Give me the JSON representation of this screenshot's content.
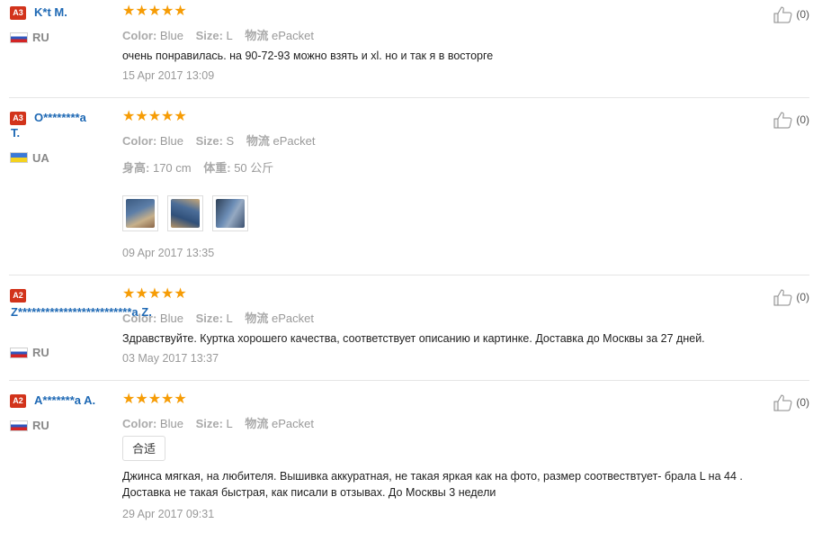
{
  "labels": {
    "color": "Color:",
    "size": "Size:",
    "shipping": "物流",
    "height": "身高:",
    "weight": "体重:"
  },
  "rating_stars": "★★★★★",
  "reviews": [
    {
      "badge": "A3",
      "name": "K*t M.",
      "country": "RU",
      "flag": "ru",
      "color": "Blue",
      "size": "L",
      "shipping": "ePacket",
      "text": "очень понравилась. на 90-72-93 можно взять и xl. но и так я в восторге",
      "date": "15 Apr 2017 13:09",
      "likes": "(0)"
    },
    {
      "badge": "A3",
      "name": "O********a T.",
      "country": "UA",
      "flag": "ua",
      "color": "Blue",
      "size": "S",
      "shipping": "ePacket",
      "height": "170 cm",
      "weight": "50 公斤",
      "photos": [
        "jacket-photo-1",
        "jacket-photo-2",
        "jacket-photo-3"
      ],
      "date": "09 Apr 2017 13:35",
      "likes": "(0)"
    },
    {
      "badge": "A2",
      "name": "Z*************************a Z.",
      "country": "RU",
      "flag": "ru",
      "color": "Blue",
      "size": "L",
      "shipping": "ePacket",
      "text": "Здравствуйте. Куртка хорошего качества, соответствует описанию и картинке. Доставка до Москвы за 27 дней.",
      "date": "03 May 2017 13:37",
      "likes": "(0)"
    },
    {
      "badge": "A2",
      "name": "A*******a A.",
      "country": "RU",
      "flag": "ru",
      "color": "Blue",
      "size": "L",
      "shipping": "ePacket",
      "tag": "合适",
      "text_line1": "Джинса мягкая, на любителя. Вышивка аккуратная, не такая яркая как на фото, размер соотвествтует- брала L на 44 .",
      "text_line2": "Доставка не такая быстрая, как писали в отзывах. До Москвы 3 недели",
      "date": "29 Apr 2017 09:31",
      "likes": "(0)"
    }
  ],
  "colors": {
    "username": "#1d68b4",
    "badge": "#d2331b",
    "stars": "#f69c05"
  },
  "icons": {
    "like": "thumbs-up-icon"
  }
}
